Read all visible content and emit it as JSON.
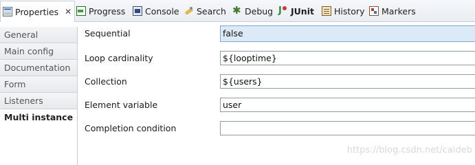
{
  "tabs": [
    {
      "label": "Properties",
      "icon": "properties-icon",
      "active": true,
      "closable": true
    },
    {
      "label": "Progress",
      "icon": "progress-icon"
    },
    {
      "label": "Console",
      "icon": "console-icon"
    },
    {
      "label": "Search",
      "icon": "search-icon"
    },
    {
      "label": "Debug",
      "icon": "debug-icon"
    },
    {
      "label": "JUnit",
      "icon": "junit-icon"
    },
    {
      "label": "History",
      "icon": "history-icon"
    },
    {
      "label": "Markers",
      "icon": "markers-icon"
    }
  ],
  "close_glyph": "✕",
  "nav": {
    "items": [
      {
        "label": "General"
      },
      {
        "label": "Main config"
      },
      {
        "label": "Documentation"
      },
      {
        "label": "Form"
      },
      {
        "label": "Listeners"
      },
      {
        "label": "Multi instance",
        "selected": true
      }
    ]
  },
  "form": {
    "rows": [
      {
        "label": "Sequential",
        "value": "false"
      },
      {
        "label": "Loop cardinality",
        "value": "${looptime}"
      },
      {
        "label": "Collection",
        "value": "${users}"
      },
      {
        "label": "Element variable",
        "value": "user"
      },
      {
        "label": "Completion condition",
        "value": ""
      }
    ]
  },
  "watermark": "https://blog.csdn.net/caideb",
  "colors": {
    "focused_field": "#dceaf7",
    "selected_nav": "#ffffff",
    "border": "#c9d0d8"
  }
}
